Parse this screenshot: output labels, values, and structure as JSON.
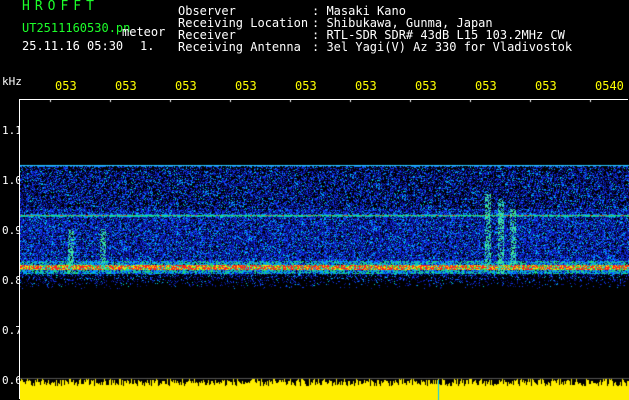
{
  "header": {
    "brand": "HROFFT",
    "filename": "UT2511160530.pn",
    "meteor_label": "meteor",
    "timestamp": "25.11.16 05:30",
    "counter": "1.",
    "info": [
      {
        "label": "Observer",
        "value": ": Masaki Kano"
      },
      {
        "label": "Receiving Location",
        "value": ": Shibukawa, Gunma, Japan"
      },
      {
        "label": "Receiver",
        "value": ": RTL-SDR SDR# 43dB L15 103.2MHz CW"
      },
      {
        "label": "Receiving Antenna",
        "value": ": 3el Yagi(V) Az 330 for Vladivostok"
      }
    ]
  },
  "axis": {
    "unit": "kHz",
    "y_ticks": [
      "1.1",
      "1.0",
      "0.9",
      "0.8",
      "0.7",
      "0.6"
    ],
    "x_ticks": [
      "053",
      "053",
      "053",
      "053",
      "053",
      "053",
      "053",
      "053",
      "053",
      "0540"
    ]
  },
  "colors": {
    "text_green": "#1cff2a",
    "tick_yellow": "#ffff00",
    "background": "#000000",
    "echo_red": "#ff2020",
    "noise_blue": "#1e3cff"
  }
}
